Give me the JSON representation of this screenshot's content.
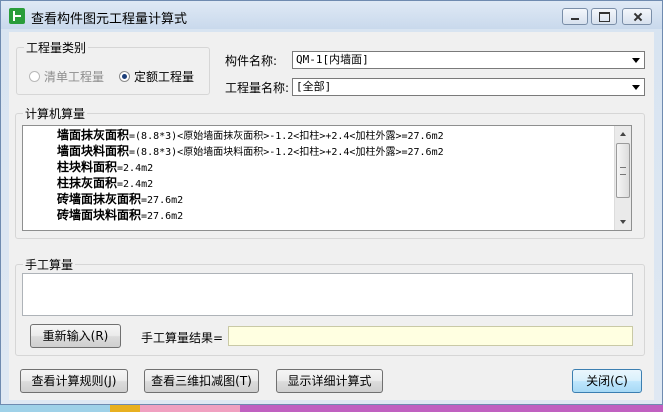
{
  "window": {
    "title": "查看构件图元工程量计算式",
    "min_label": "",
    "max_label": "",
    "close_label": ""
  },
  "quantity_type": {
    "group_label": "工程量类别",
    "options": [
      {
        "label": "清单工程量",
        "checked": false,
        "enabled": false
      },
      {
        "label": "定额工程量",
        "checked": true,
        "enabled": true
      }
    ]
  },
  "component": {
    "label": "构件名称:",
    "value": "QM-1[内墙面]"
  },
  "quantity_name": {
    "label": "工程量名称:",
    "value": "[全部]"
  },
  "computer_calc": {
    "group_label": "计算机算量",
    "lines": [
      {
        "name": "墙面抹灰面积",
        "formula": "=(8.8*3)<原始墙面抹灰面积>-1.2<扣柱>+2.4<加柱外露>=27.6m2"
      },
      {
        "name": "墙面块料面积",
        "formula": "=(8.8*3)<原始墙面块料面积>-1.2<扣柱>+2.4<加柱外露>=27.6m2"
      },
      {
        "name": "柱块料面积",
        "formula": "=2.4m2"
      },
      {
        "name": "柱抹灰面积",
        "formula": "=2.4m2"
      },
      {
        "name": "砖墙面抹灰面积",
        "formula": "=27.6m2"
      },
      {
        "name": "砖墙面块料面积",
        "formula": "=27.6m2"
      }
    ]
  },
  "manual_calc": {
    "group_label": "手工算量",
    "input_value": "",
    "reenter_button": "重新输入(R)",
    "result_label": "手工算量结果=",
    "result_value": ""
  },
  "footer": {
    "view_rules_button": "查看计算规则(J)",
    "view_3d_button": "查看三维扣减图(T)",
    "show_detail_button": "显示详细计算式",
    "close_button": "关闭(C)"
  },
  "colors": {
    "title_bg": "#c9d9ec",
    "client_bg": "#f0f0f0",
    "result_bg": "#ffffe1",
    "default_button": "#bee6fd"
  }
}
